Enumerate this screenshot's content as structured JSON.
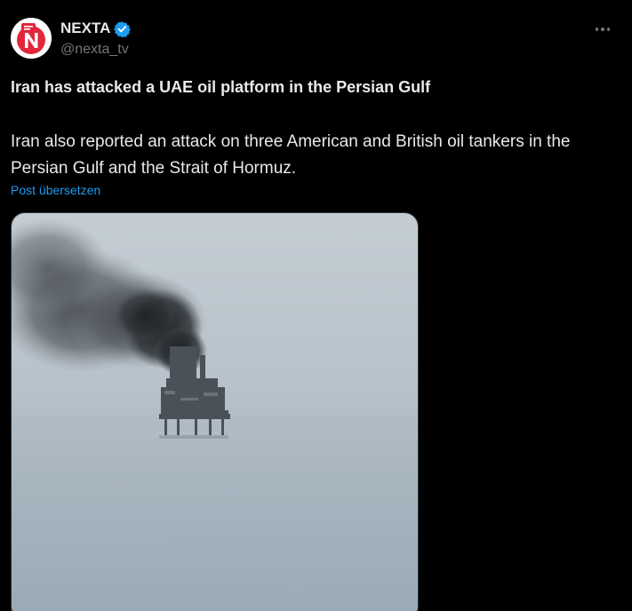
{
  "author": {
    "display_name": "NEXTA",
    "handle": "@nexta_tv",
    "verified": true,
    "avatar_icon": "nexta-logo-icon"
  },
  "post": {
    "headline": "Iran has attacked a UAE oil platform in the Persian Gulf",
    "body": "Iran also reported an attack on three American and British oil tankers in the Persian Gulf and the Strait of Hormuz.",
    "translate_label": "Post übersetzen"
  },
  "media": {
    "kind": "photo",
    "subject": "smoking-oil-platform-at-sea"
  },
  "icons": {
    "more": "more-horizontal-icon",
    "verified": "verified-badge-icon"
  },
  "colors": {
    "background": "#000000",
    "text_primary": "#e7e9ea",
    "text_secondary": "#71767b",
    "link": "#1d9bf0",
    "verified": "#1d9bf0",
    "brand_red": "#e2263b"
  }
}
